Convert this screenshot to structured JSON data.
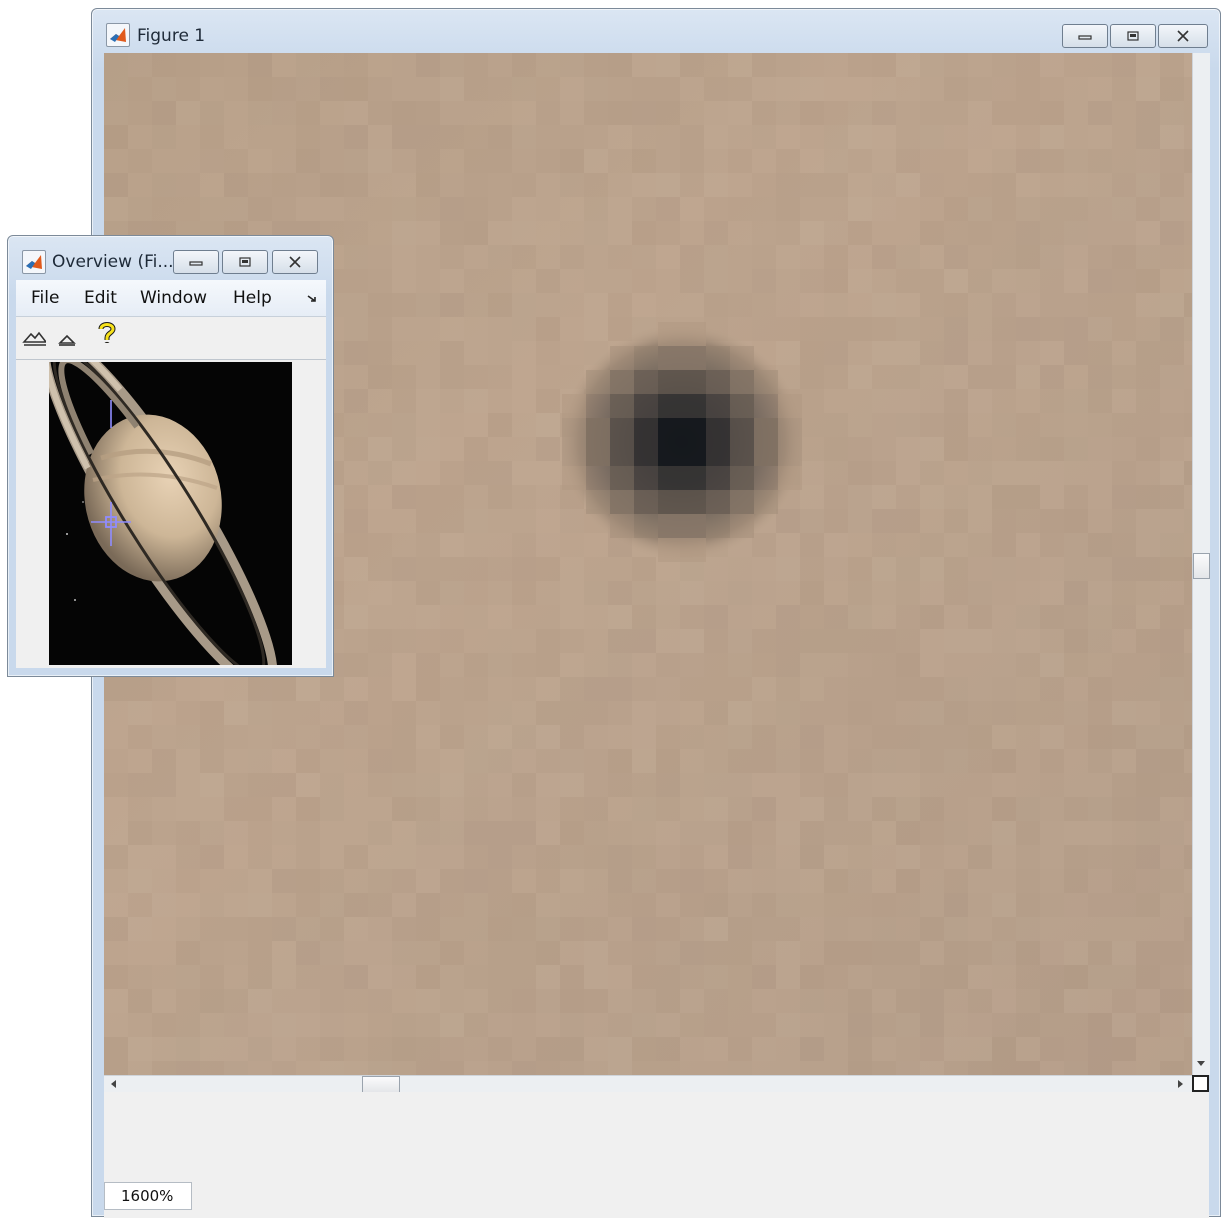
{
  "figure_window": {
    "title": "Figure 1",
    "zoom_level": "1600%"
  },
  "overview_window": {
    "title": "Overview (Fi...",
    "menu": [
      "File",
      "Edit",
      "Window",
      "Help"
    ],
    "menu_overflow_icon": "menu-overflow-arrow",
    "toolbar": [
      "zoom-in-icon",
      "zoom-out-icon",
      "help-icon"
    ]
  },
  "colors": {
    "title_bar": "#c9d9ec",
    "image_background": "#b9a18a",
    "overview_background": "#050505",
    "crosshair": "#8f8cff"
  }
}
